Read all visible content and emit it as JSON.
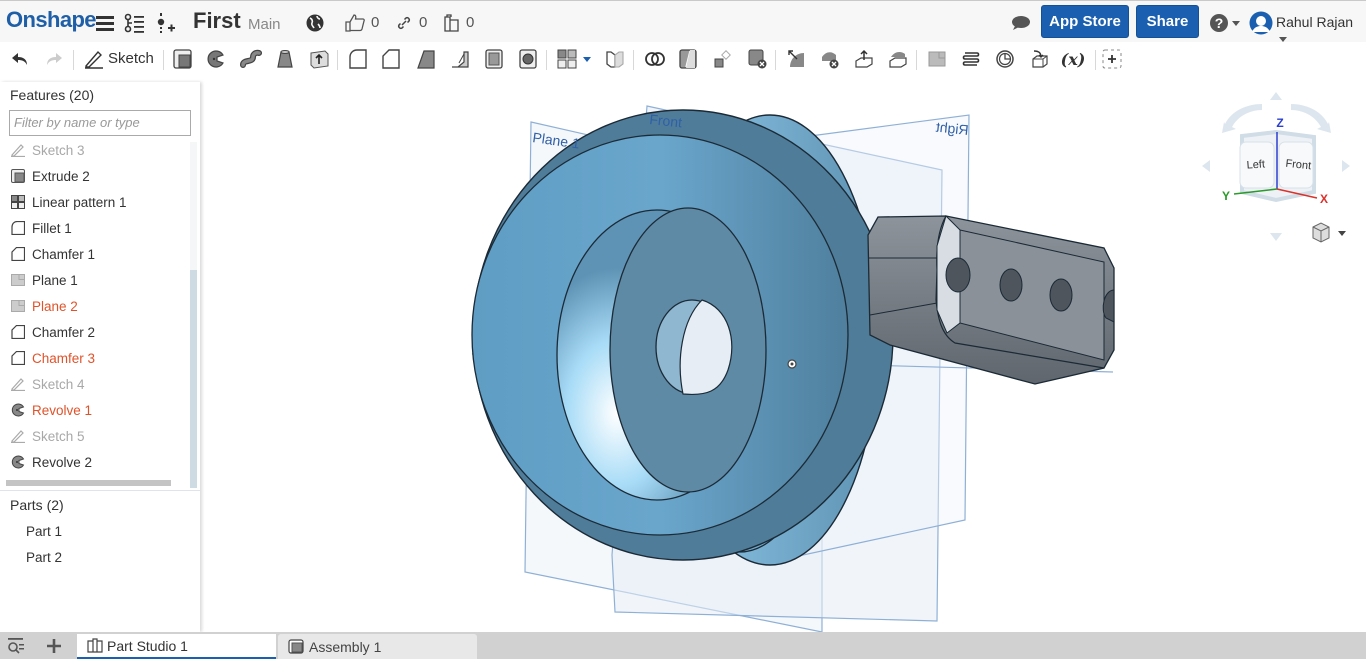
{
  "header": {
    "logo": "Onshape",
    "menu_icon": "hamburger-menu-icon",
    "versions_icon": "version-graph-icon",
    "branch_icon": "create-branch-icon",
    "document_title": "First",
    "branch_name": "Main",
    "public_icon": "globe-icon",
    "likes_count": "0",
    "links_count": "0",
    "copies_count": "0",
    "comments_icon": "comment-icon",
    "app_store_label": "App Store",
    "share_label": "Share",
    "help_icon": "help-icon",
    "user_name": "Rahul Rajan"
  },
  "toolbar": {
    "undo_icon": "undo-icon",
    "redo_icon": "redo-icon",
    "sketch_label": "Sketch",
    "tools": [
      "extrude",
      "revolve",
      "sweep",
      "loft",
      "thicken",
      "fillet",
      "chamfer",
      "draft",
      "rib",
      "shell",
      "hole",
      "linear-pattern",
      "mirror",
      "boolean",
      "split",
      "transform",
      "delete-part",
      "modify-fillet",
      "delete-face",
      "move-face",
      "replace-face",
      "plane",
      "helix",
      "mate-connector",
      "variable-insert",
      "variable",
      "add-custom-feature"
    ],
    "variable_label": "(x)"
  },
  "feature_panel": {
    "title": "Features (20)",
    "filter_placeholder": "Filter by name or type",
    "features": [
      {
        "label": "Sketch 3",
        "icon": "sketch",
        "state": "suppressed"
      },
      {
        "label": "Extrude 2",
        "icon": "extrude",
        "state": "normal"
      },
      {
        "label": "Linear pattern 1",
        "icon": "linear-pattern",
        "state": "normal"
      },
      {
        "label": "Fillet 1",
        "icon": "fillet",
        "state": "normal"
      },
      {
        "label": "Chamfer 1",
        "icon": "chamfer",
        "state": "normal"
      },
      {
        "label": "Plane 1",
        "icon": "plane",
        "state": "normal"
      },
      {
        "label": "Plane 2",
        "icon": "plane",
        "state": "error"
      },
      {
        "label": "Chamfer 2",
        "icon": "chamfer",
        "state": "normal"
      },
      {
        "label": "Chamfer 3",
        "icon": "chamfer",
        "state": "error"
      },
      {
        "label": "Sketch 4",
        "icon": "sketch",
        "state": "suppressed"
      },
      {
        "label": "Revolve 1",
        "icon": "revolve",
        "state": "error"
      },
      {
        "label": "Sketch 5",
        "icon": "sketch",
        "state": "suppressed"
      },
      {
        "label": "Revolve 2",
        "icon": "revolve",
        "state": "normal"
      }
    ],
    "parts_title": "Parts (2)",
    "parts": [
      "Part 1",
      "Part 2"
    ]
  },
  "viewport": {
    "planes": [
      "Plane 1",
      "Front",
      "Right"
    ]
  },
  "view_cube": {
    "faces": [
      "Left",
      "Front"
    ],
    "axes": [
      "X",
      "Y",
      "Z"
    ],
    "axis_colors": {
      "X": "#d9322b",
      "Y": "#2a9a2a",
      "Z": "#2b3fd0"
    }
  },
  "bottom_tabs": {
    "tabs": [
      {
        "label": "Part Studio 1",
        "icon": "part-studio",
        "active": true
      },
      {
        "label": "Assembly 1",
        "icon": "assembly",
        "active": false
      }
    ]
  },
  "colors": {
    "brand": "#1f5fa8",
    "button": "#1a5fb0",
    "error": "#e0532a",
    "suppressed": "#a8a8a8",
    "part_blue": "#8ec8ea",
    "part_gray": "#6e767e"
  }
}
